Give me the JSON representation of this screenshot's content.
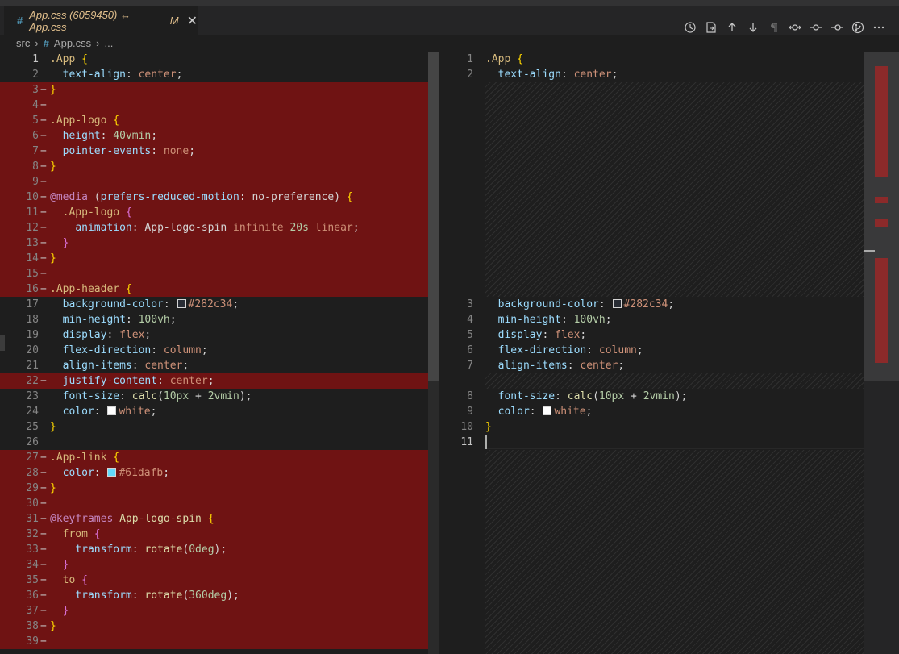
{
  "tab": {
    "hash": "#",
    "title": "App.css (6059450) ↔ App.css",
    "modified": "M",
    "close": "✕"
  },
  "actions": [
    {
      "icon": "history-icon"
    },
    {
      "icon": "open-file-icon"
    },
    {
      "icon": "arrow-up-icon"
    },
    {
      "icon": "arrow-down-icon"
    },
    {
      "icon": "pilcrow-icon"
    },
    {
      "icon": "git-compare-icon"
    },
    {
      "icon": "git-commit-icon"
    },
    {
      "icon": "git-commit-next-icon"
    },
    {
      "icon": "source-control-icon"
    },
    {
      "icon": "more-icon"
    }
  ],
  "breadcrumb": {
    "folder": "src",
    "hash": "#",
    "file": "App.css",
    "more": "..."
  },
  "left_lines": [
    {
      "n": "1",
      "del": false,
      "seg": [
        [
          "k-sel",
          ".App"
        ],
        [
          "k-plain",
          " "
        ],
        [
          "k-brace",
          "{"
        ]
      ]
    },
    {
      "n": "2",
      "del": false,
      "seg": [
        [
          "k-plain",
          "  "
        ],
        [
          "k-prop",
          "text-align"
        ],
        [
          "k-plain",
          ": "
        ],
        [
          "k-val",
          "center"
        ],
        [
          "k-plain",
          ";"
        ]
      ]
    },
    {
      "n": "3",
      "del": true,
      "seg": [
        [
          "k-brace",
          "}"
        ]
      ]
    },
    {
      "n": "4",
      "del": true,
      "seg": []
    },
    {
      "n": "5",
      "del": true,
      "seg": [
        [
          "k-sel",
          ".App-logo"
        ],
        [
          "k-plain",
          " "
        ],
        [
          "k-brace",
          "{"
        ]
      ]
    },
    {
      "n": "6",
      "del": true,
      "seg": [
        [
          "k-plain",
          "  "
        ],
        [
          "k-prop",
          "height"
        ],
        [
          "k-plain",
          ": "
        ],
        [
          "k-num",
          "40vmin"
        ],
        [
          "k-plain",
          ";"
        ]
      ]
    },
    {
      "n": "7",
      "del": true,
      "seg": [
        [
          "k-plain",
          "  "
        ],
        [
          "k-prop",
          "pointer-events"
        ],
        [
          "k-plain",
          ": "
        ],
        [
          "k-val",
          "none"
        ],
        [
          "k-plain",
          ";"
        ]
      ]
    },
    {
      "n": "8",
      "del": true,
      "seg": [
        [
          "k-brace",
          "}"
        ]
      ]
    },
    {
      "n": "9",
      "del": true,
      "seg": []
    },
    {
      "n": "10",
      "del": true,
      "seg": [
        [
          "k-at",
          "@media"
        ],
        [
          "k-plain",
          " ("
        ],
        [
          "k-prop",
          "prefers-reduced-motion"
        ],
        [
          "k-plain",
          ": no-preference) "
        ],
        [
          "k-brace",
          "{"
        ]
      ]
    },
    {
      "n": "11",
      "del": true,
      "seg": [
        [
          "k-plain",
          "  "
        ],
        [
          "k-sel",
          ".App-logo"
        ],
        [
          "k-plain",
          " "
        ],
        [
          "k-brace2",
          "{"
        ]
      ]
    },
    {
      "n": "12",
      "del": true,
      "seg": [
        [
          "k-plain",
          "    "
        ],
        [
          "k-prop",
          "animation"
        ],
        [
          "k-plain",
          ": App-logo-spin "
        ],
        [
          "k-val",
          "infinite"
        ],
        [
          "k-plain",
          " "
        ],
        [
          "k-num",
          "20s"
        ],
        [
          "k-plain",
          " "
        ],
        [
          "k-val",
          "linear"
        ],
        [
          "k-plain",
          ";"
        ]
      ]
    },
    {
      "n": "13",
      "del": true,
      "seg": [
        [
          "k-plain",
          "  "
        ],
        [
          "k-brace2",
          "}"
        ]
      ]
    },
    {
      "n": "14",
      "del": true,
      "seg": [
        [
          "k-brace",
          "}"
        ]
      ]
    },
    {
      "n": "15",
      "del": true,
      "seg": []
    },
    {
      "n": "16",
      "del": true,
      "seg": [
        [
          "k-sel",
          ".App-header"
        ],
        [
          "k-plain",
          " "
        ],
        [
          "k-brace",
          "{"
        ]
      ]
    },
    {
      "n": "17",
      "del": false,
      "seg": [
        [
          "k-plain",
          "  "
        ],
        [
          "k-prop",
          "background-color"
        ],
        [
          "k-plain",
          ": "
        ],
        [
          "swatch",
          "#282c34"
        ],
        [
          "k-val",
          "#282c34"
        ],
        [
          "k-plain",
          ";"
        ]
      ]
    },
    {
      "n": "18",
      "del": false,
      "seg": [
        [
          "k-plain",
          "  "
        ],
        [
          "k-prop",
          "min-height"
        ],
        [
          "k-plain",
          ": "
        ],
        [
          "k-num",
          "100vh"
        ],
        [
          "k-plain",
          ";"
        ]
      ]
    },
    {
      "n": "19",
      "del": false,
      "seg": [
        [
          "k-plain",
          "  "
        ],
        [
          "k-prop",
          "display"
        ],
        [
          "k-plain",
          ": "
        ],
        [
          "k-val",
          "flex"
        ],
        [
          "k-plain",
          ";"
        ]
      ]
    },
    {
      "n": "20",
      "del": false,
      "seg": [
        [
          "k-plain",
          "  "
        ],
        [
          "k-prop",
          "flex-direction"
        ],
        [
          "k-plain",
          ": "
        ],
        [
          "k-val",
          "column"
        ],
        [
          "k-plain",
          ";"
        ]
      ]
    },
    {
      "n": "21",
      "del": false,
      "seg": [
        [
          "k-plain",
          "  "
        ],
        [
          "k-prop",
          "align-items"
        ],
        [
          "k-plain",
          ": "
        ],
        [
          "k-val",
          "center"
        ],
        [
          "k-plain",
          ";"
        ]
      ]
    },
    {
      "n": "22",
      "del": true,
      "seg": [
        [
          "k-plain",
          "  "
        ],
        [
          "k-prop",
          "justify-content"
        ],
        [
          "k-plain",
          ": "
        ],
        [
          "k-val",
          "center"
        ],
        [
          "k-plain",
          ";"
        ]
      ]
    },
    {
      "n": "23",
      "del": false,
      "seg": [
        [
          "k-plain",
          "  "
        ],
        [
          "k-prop",
          "font-size"
        ],
        [
          "k-plain",
          ": "
        ],
        [
          "k-fn",
          "calc"
        ],
        [
          "k-plain",
          "("
        ],
        [
          "k-num",
          "10px"
        ],
        [
          "k-plain",
          " + "
        ],
        [
          "k-num",
          "2vmin"
        ],
        [
          "k-plain",
          ");"
        ]
      ]
    },
    {
      "n": "24",
      "del": false,
      "seg": [
        [
          "k-plain",
          "  "
        ],
        [
          "k-prop",
          "color"
        ],
        [
          "k-plain",
          ": "
        ],
        [
          "swatch",
          "#ffffff"
        ],
        [
          "k-val",
          "white"
        ],
        [
          "k-plain",
          ";"
        ]
      ]
    },
    {
      "n": "25",
      "del": false,
      "seg": [
        [
          "k-brace",
          "}"
        ]
      ]
    },
    {
      "n": "26",
      "del": false,
      "seg": []
    },
    {
      "n": "27",
      "del": true,
      "seg": [
        [
          "k-sel",
          ".App-link"
        ],
        [
          "k-plain",
          " "
        ],
        [
          "k-brace",
          "{"
        ]
      ]
    },
    {
      "n": "28",
      "del": true,
      "seg": [
        [
          "k-plain",
          "  "
        ],
        [
          "k-prop",
          "color"
        ],
        [
          "k-plain",
          ": "
        ],
        [
          "swatch",
          "#61dafb"
        ],
        [
          "k-val",
          "#61dafb"
        ],
        [
          "k-plain",
          ";"
        ]
      ]
    },
    {
      "n": "29",
      "del": true,
      "seg": [
        [
          "k-brace",
          "}"
        ]
      ]
    },
    {
      "n": "30",
      "del": true,
      "seg": []
    },
    {
      "n": "31",
      "del": true,
      "seg": [
        [
          "k-at",
          "@keyframes"
        ],
        [
          "k-plain",
          " "
        ],
        [
          "k-fn",
          "App-logo-spin"
        ],
        [
          "k-plain",
          " "
        ],
        [
          "k-brace",
          "{"
        ]
      ]
    },
    {
      "n": "32",
      "del": true,
      "seg": [
        [
          "k-plain",
          "  "
        ],
        [
          "k-sel",
          "from"
        ],
        [
          "k-plain",
          " "
        ],
        [
          "k-brace2",
          "{"
        ]
      ]
    },
    {
      "n": "33",
      "del": true,
      "seg": [
        [
          "k-plain",
          "    "
        ],
        [
          "k-prop",
          "transform"
        ],
        [
          "k-plain",
          ": "
        ],
        [
          "k-fn",
          "rotate"
        ],
        [
          "k-plain",
          "("
        ],
        [
          "k-num",
          "0deg"
        ],
        [
          "k-plain",
          ");"
        ]
      ]
    },
    {
      "n": "34",
      "del": true,
      "seg": [
        [
          "k-plain",
          "  "
        ],
        [
          "k-brace2",
          "}"
        ]
      ]
    },
    {
      "n": "35",
      "del": true,
      "seg": [
        [
          "k-plain",
          "  "
        ],
        [
          "k-sel",
          "to"
        ],
        [
          "k-plain",
          " "
        ],
        [
          "k-brace2",
          "{"
        ]
      ]
    },
    {
      "n": "36",
      "del": true,
      "seg": [
        [
          "k-plain",
          "    "
        ],
        [
          "k-prop",
          "transform"
        ],
        [
          "k-plain",
          ": "
        ],
        [
          "k-fn",
          "rotate"
        ],
        [
          "k-plain",
          "("
        ],
        [
          "k-num",
          "360deg"
        ],
        [
          "k-plain",
          ");"
        ]
      ]
    },
    {
      "n": "37",
      "del": true,
      "seg": [
        [
          "k-plain",
          "  "
        ],
        [
          "k-brace2",
          "}"
        ]
      ]
    },
    {
      "n": "38",
      "del": true,
      "seg": [
        [
          "k-brace",
          "}"
        ]
      ]
    },
    {
      "n": "39",
      "del": true,
      "seg": []
    }
  ],
  "right_lines": [
    {
      "n": "1",
      "row": 0,
      "seg": [
        [
          "k-sel",
          ".App"
        ],
        [
          "k-plain",
          " "
        ],
        [
          "k-brace",
          "{"
        ]
      ]
    },
    {
      "n": "2",
      "row": 1,
      "seg": [
        [
          "k-plain",
          "  "
        ],
        [
          "k-prop",
          "text-align"
        ],
        [
          "k-plain",
          ": "
        ],
        [
          "k-val",
          "center"
        ],
        [
          "k-plain",
          ";"
        ]
      ]
    },
    {
      "n": "3",
      "row": 16,
      "seg": [
        [
          "k-plain",
          "  "
        ],
        [
          "k-prop",
          "background-color"
        ],
        [
          "k-plain",
          ": "
        ],
        [
          "swatch",
          "#282c34"
        ],
        [
          "k-val",
          "#282c34"
        ],
        [
          "k-plain",
          ";"
        ]
      ]
    },
    {
      "n": "4",
      "row": 17,
      "seg": [
        [
          "k-plain",
          "  "
        ],
        [
          "k-prop",
          "min-height"
        ],
        [
          "k-plain",
          ": "
        ],
        [
          "k-num",
          "100vh"
        ],
        [
          "k-plain",
          ";"
        ]
      ]
    },
    {
      "n": "5",
      "row": 18,
      "seg": [
        [
          "k-plain",
          "  "
        ],
        [
          "k-prop",
          "display"
        ],
        [
          "k-plain",
          ": "
        ],
        [
          "k-val",
          "flex"
        ],
        [
          "k-plain",
          ";"
        ]
      ]
    },
    {
      "n": "6",
      "row": 19,
      "seg": [
        [
          "k-plain",
          "  "
        ],
        [
          "k-prop",
          "flex-direction"
        ],
        [
          "k-plain",
          ": "
        ],
        [
          "k-val",
          "column"
        ],
        [
          "k-plain",
          ";"
        ]
      ]
    },
    {
      "n": "7",
      "row": 20,
      "seg": [
        [
          "k-plain",
          "  "
        ],
        [
          "k-prop",
          "align-items"
        ],
        [
          "k-plain",
          ": "
        ],
        [
          "k-val",
          "center"
        ],
        [
          "k-plain",
          ";"
        ]
      ]
    },
    {
      "n": "8",
      "row": 22,
      "seg": [
        [
          "k-plain",
          "  "
        ],
        [
          "k-prop",
          "font-size"
        ],
        [
          "k-plain",
          ": "
        ],
        [
          "k-fn",
          "calc"
        ],
        [
          "k-plain",
          "("
        ],
        [
          "k-num",
          "10px"
        ],
        [
          "k-plain",
          " + "
        ],
        [
          "k-num",
          "2vmin"
        ],
        [
          "k-plain",
          ");"
        ]
      ]
    },
    {
      "n": "9",
      "row": 23,
      "seg": [
        [
          "k-plain",
          "  "
        ],
        [
          "k-prop",
          "color"
        ],
        [
          "k-plain",
          ": "
        ],
        [
          "swatch",
          "#ffffff"
        ],
        [
          "k-val",
          "white"
        ],
        [
          "k-plain",
          ";"
        ]
      ]
    },
    {
      "n": "10",
      "row": 24,
      "seg": [
        [
          "k-brace",
          "}"
        ]
      ]
    },
    {
      "n": "11",
      "row": 25,
      "seg": []
    }
  ],
  "colors": {
    "deleted_bg": "#6f1313",
    "editor_bg": "#1e1e1e"
  }
}
